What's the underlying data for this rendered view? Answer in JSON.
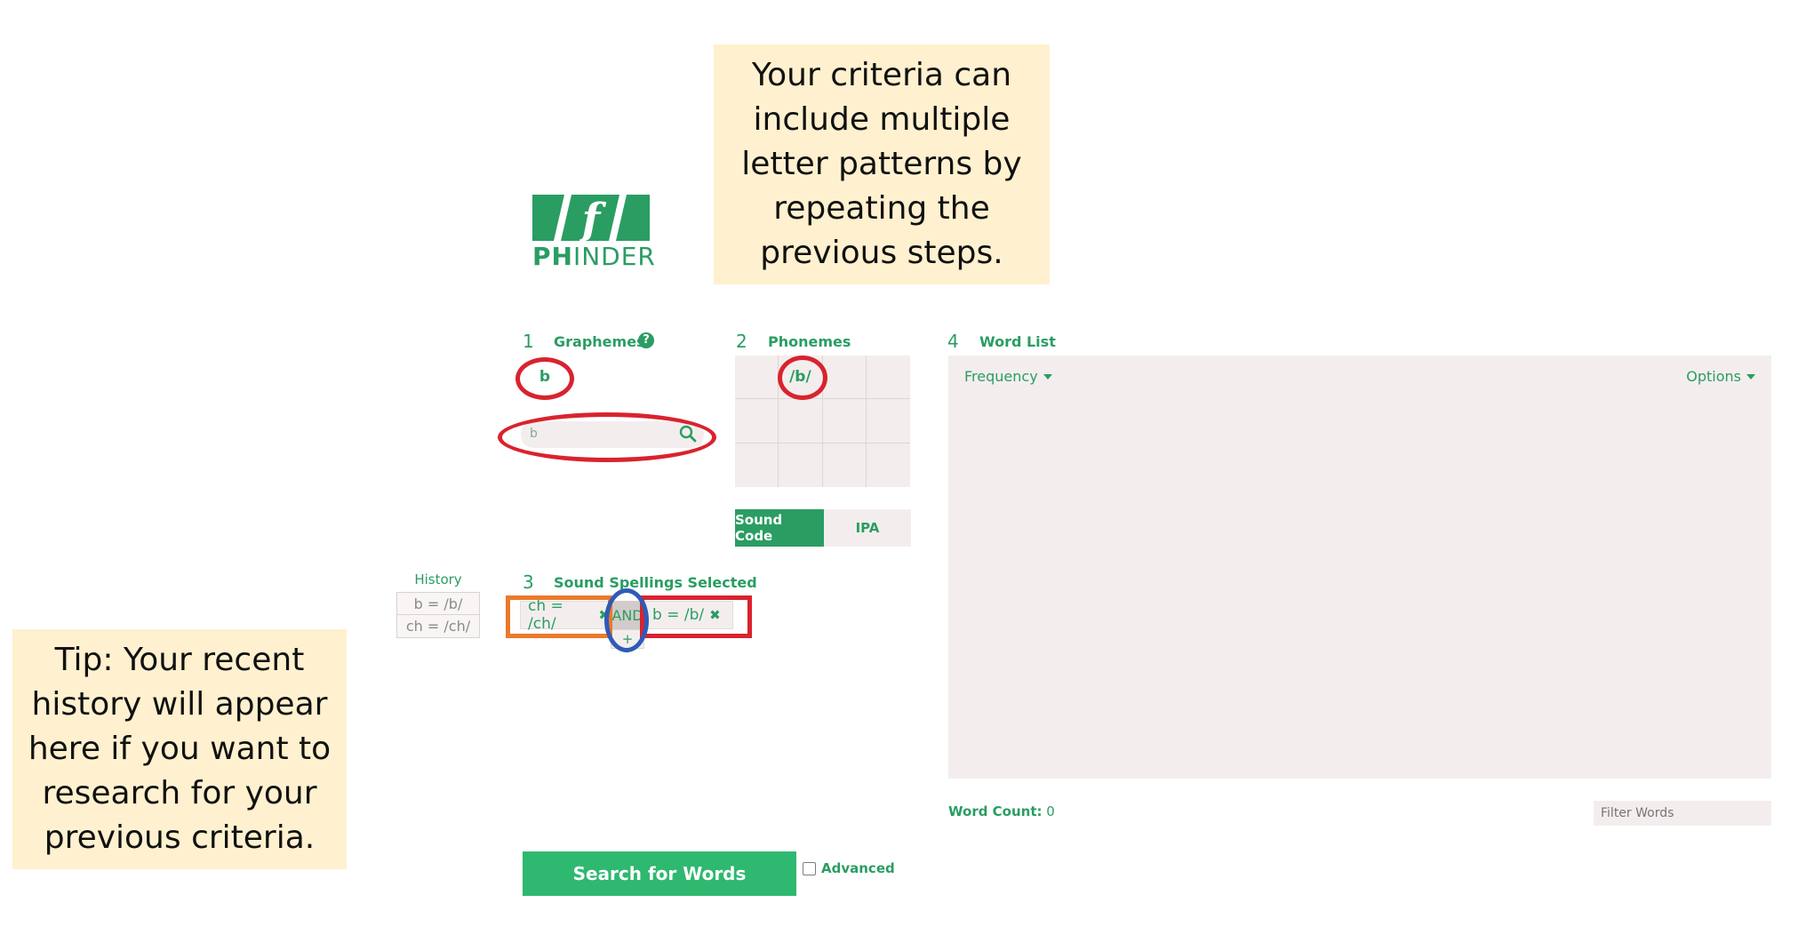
{
  "callouts": {
    "top": "Your criteria can\ninclude multiple\nletter patterns by\nrepeating the\nprevious steps.",
    "tip": "Tip: Your recent\nhistory will appear\nhere if you want to\nresearch for your\nprevious criteria."
  },
  "logo": {
    "mark": "f",
    "brand_bold": "PH",
    "brand_rest": "INDER"
  },
  "graphemes": {
    "number": "1",
    "title": "Graphemes",
    "help_glyph": "?",
    "selected": "b",
    "search_value": "b"
  },
  "phonemes": {
    "number": "2",
    "title": "Phonemes",
    "selected": "/b/",
    "mode_buttons": [
      "Sound Code",
      "IPA"
    ]
  },
  "word_list": {
    "number": "4",
    "title": "Word List",
    "sort_label": "Frequency",
    "options_label": "Options"
  },
  "history": {
    "title": "History",
    "items": [
      "b = /b/",
      "ch = /ch/"
    ]
  },
  "sound_spellings": {
    "number": "3",
    "title": "Sound Spellings Selected",
    "chip1": "ch = /ch/",
    "operator": "AND",
    "chip2": "b = /b/",
    "add": "+",
    "remove_glyph": "✖"
  },
  "word_count": {
    "label": "Word Count:",
    "value": "0"
  },
  "filter": {
    "placeholder": "Filter Words"
  },
  "search_button": "Search for Words",
  "advanced_label": "Advanced",
  "colors": {
    "brand_green": "#2a9d62",
    "panel": "#f3eeed",
    "callout": "#fff1cf",
    "mark_red": "#d9232e",
    "mark_orange": "#ec7a2a",
    "mark_blue": "#2f5bb8"
  }
}
